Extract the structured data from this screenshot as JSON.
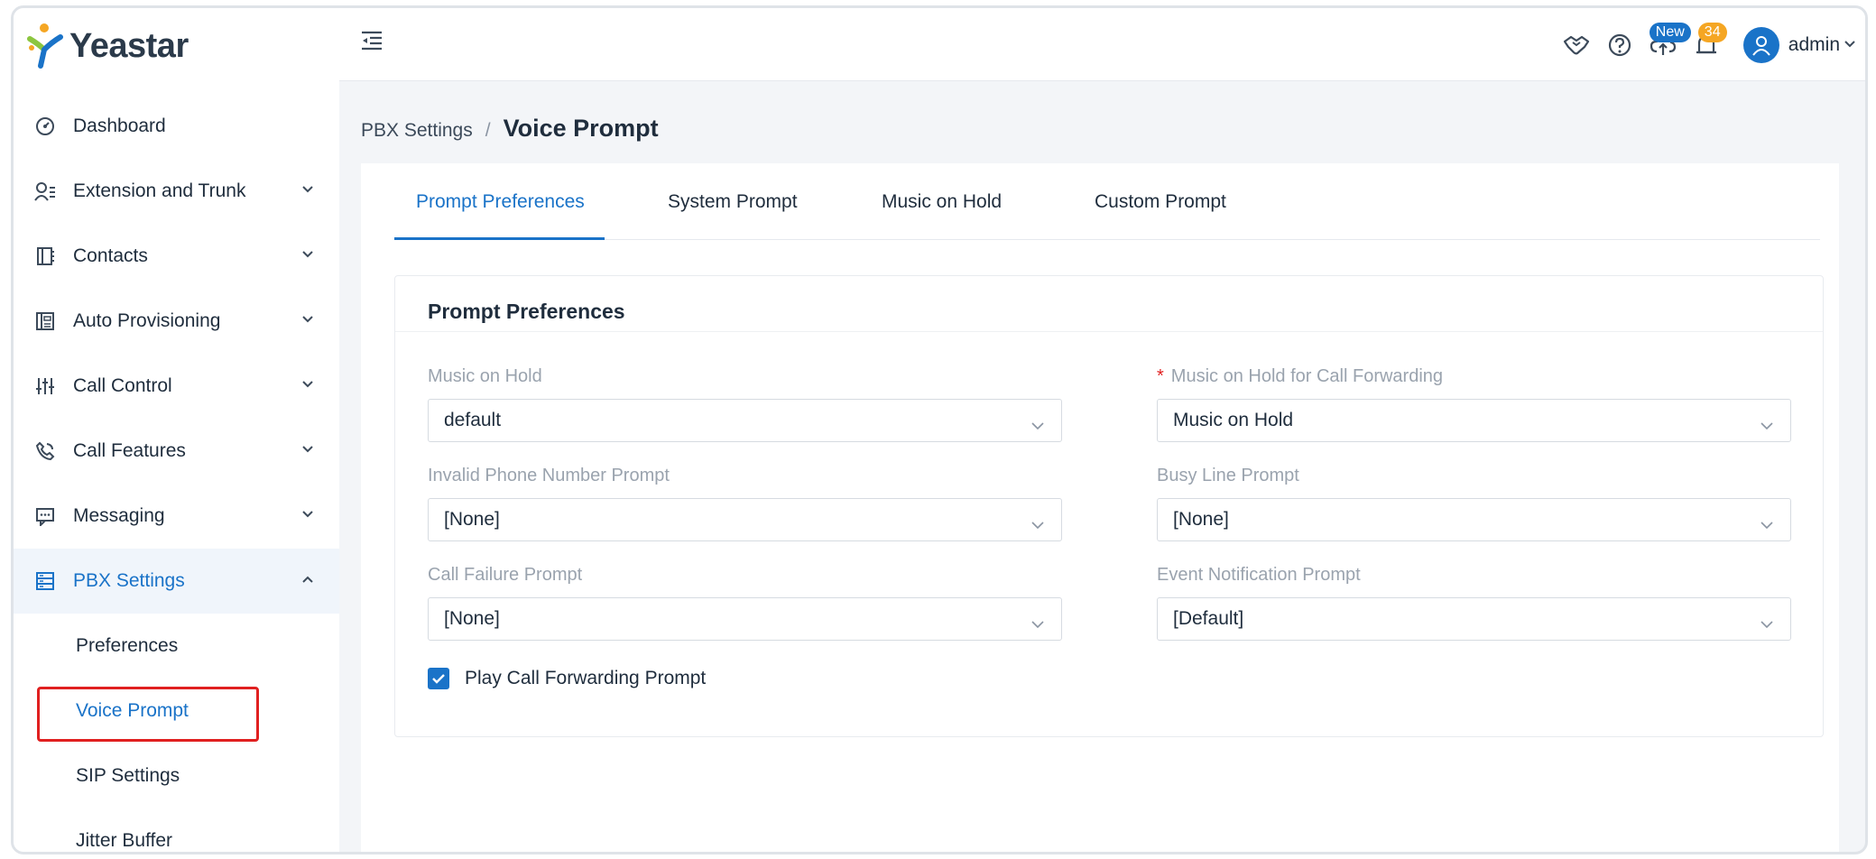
{
  "brand": {
    "name": "Yeastar"
  },
  "sidebar": {
    "items": [
      {
        "label": "Dashboard",
        "icon": "dashboard-icon"
      },
      {
        "label": "Extension and Trunk",
        "icon": "extension-icon"
      },
      {
        "label": "Contacts",
        "icon": "contacts-icon"
      },
      {
        "label": "Auto Provisioning",
        "icon": "provisioning-icon"
      },
      {
        "label": "Call Control",
        "icon": "call-control-icon"
      },
      {
        "label": "Call Features",
        "icon": "call-features-icon"
      },
      {
        "label": "Messaging",
        "icon": "messaging-icon"
      },
      {
        "label": "PBX Settings",
        "icon": "pbx-settings-icon",
        "expanded": true
      }
    ],
    "sub_items": [
      {
        "label": "Preferences"
      },
      {
        "label": "Voice Prompt",
        "active": true
      },
      {
        "label": "SIP Settings"
      },
      {
        "label": "Jitter Buffer"
      }
    ]
  },
  "header": {
    "badge_new": "New",
    "badge_count": "34",
    "user": "admin"
  },
  "breadcrumb": {
    "parent": "PBX Settings",
    "separator": "/",
    "current": "Voice Prompt"
  },
  "tabs": [
    {
      "label": "Prompt Preferences",
      "active": true
    },
    {
      "label": "System Prompt"
    },
    {
      "label": "Music on Hold"
    },
    {
      "label": "Custom Prompt"
    }
  ],
  "card": {
    "title": "Prompt Preferences",
    "fields": {
      "music_on_hold": {
        "label": "Music on Hold",
        "value": "default"
      },
      "moh_call_forwarding": {
        "label": "Music on Hold for Call Forwarding",
        "required_mark": "*",
        "value": "Music on Hold"
      },
      "invalid_number": {
        "label": "Invalid Phone Number Prompt",
        "value": "[None]"
      },
      "busy_line": {
        "label": "Busy Line Prompt",
        "value": "[None]"
      },
      "call_failure": {
        "label": "Call Failure Prompt",
        "value": "[None]"
      },
      "event_notification": {
        "label": "Event Notification Prompt",
        "value": "[Default]"
      }
    },
    "checkbox": {
      "label": "Play Call Forwarding Prompt",
      "checked": true
    }
  },
  "colors": {
    "accent": "#1a73c8",
    "highlight": "#e02020",
    "badge_orange": "#f5a623"
  }
}
